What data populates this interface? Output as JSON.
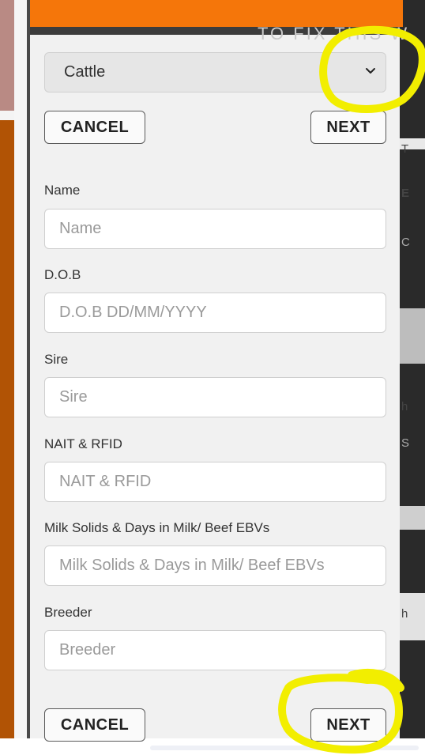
{
  "header": {
    "ghost_text": "TO FIX THIS W"
  },
  "background": {
    "right_fragments": [
      "T",
      "E",
      "C",
      "h",
      "S",
      "h"
    ]
  },
  "form": {
    "animal_select": {
      "value": "Cattle"
    },
    "top_buttons": {
      "cancel": "CANCEL",
      "next": "NEXT"
    },
    "fields": [
      {
        "label": "Name",
        "placeholder": "Name"
      },
      {
        "label": "D.O.B",
        "placeholder": "D.O.B DD/MM/YYYY"
      },
      {
        "label": "Sire",
        "placeholder": "Sire"
      },
      {
        "label": "NAIT & RFID",
        "placeholder": "NAIT & RFID"
      },
      {
        "label": "Milk Solids & Days in Milk/ Beef EBVs",
        "placeholder": "Milk Solids & Days in Milk/ Beef EBVs"
      },
      {
        "label": "Breeder",
        "placeholder": "Breeder"
      }
    ],
    "bottom_buttons": {
      "cancel": "CANCEL",
      "next": "NEXT"
    }
  },
  "annotations": {
    "highlight_color": "#f2ee00"
  }
}
